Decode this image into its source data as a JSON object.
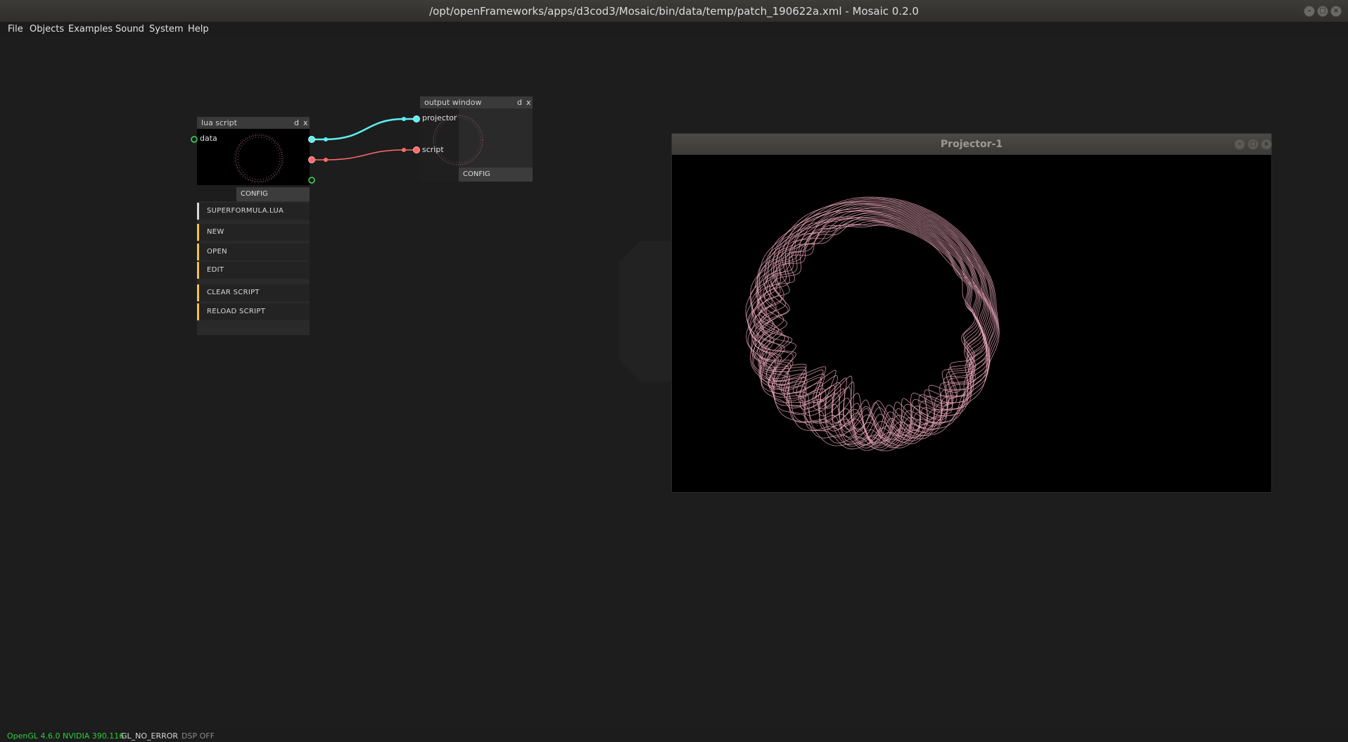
{
  "window": {
    "title": "/opt/openFrameworks/apps/d3cod3/Mosaic/bin/data/temp/patch_190622a.xml - Mosaic 0.2.0",
    "minimize_glyph": "–",
    "maximize_glyph": "□",
    "close_glyph": "×"
  },
  "menubar": [
    "File",
    "Objects",
    "Examples",
    "Sound",
    "System",
    "Help"
  ],
  "lua_node": {
    "title": "lua script",
    "ctl_d": "d",
    "ctl_x": "x",
    "inlet_label": "data",
    "config_label": "CONFIG",
    "file_button": "SUPERFORMULA.LUA",
    "buttons": [
      "NEW",
      "OPEN",
      "EDIT",
      "CLEAR SCRIPT",
      "RELOAD SCRIPT"
    ]
  },
  "output_node": {
    "title": "output window",
    "ctl_d": "d",
    "ctl_x": "x",
    "inlets": [
      "projector",
      "script"
    ],
    "config_label": "CONFIG"
  },
  "projector": {
    "title": "Projector-1",
    "stroke_color": "#e6a3b6"
  },
  "colors": {
    "cable_texture": "#5ef0f0",
    "cable_script": "#ff6b6b",
    "port_green": "#3ddc5c",
    "button_accent": "#f0c24a"
  },
  "status": {
    "gl": "OpenGL 4.6.0 NVIDIA 390.116",
    "error": "GL_NO_ERROR",
    "dsp": "DSP OFF"
  }
}
